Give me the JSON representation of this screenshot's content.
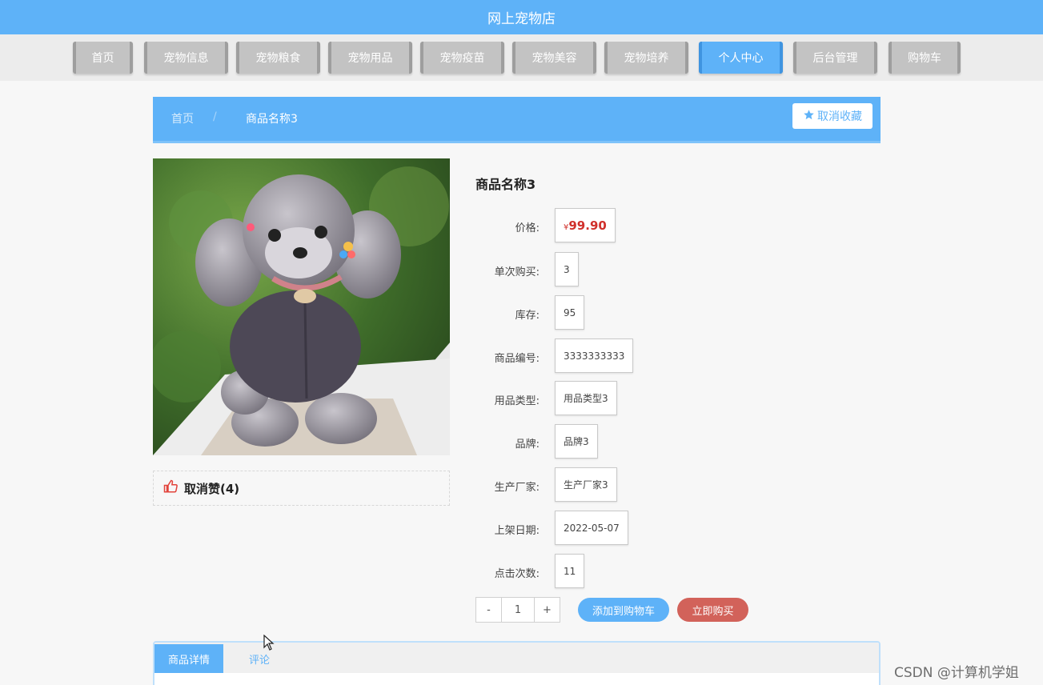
{
  "header": {
    "title": "网上宠物店"
  },
  "nav": {
    "items": [
      {
        "label": "首页",
        "active": false
      },
      {
        "label": "宠物信息",
        "active": false
      },
      {
        "label": "宠物粮食",
        "active": false
      },
      {
        "label": "宠物用品",
        "active": false
      },
      {
        "label": "宠物疫苗",
        "active": false
      },
      {
        "label": "宠物美容",
        "active": false
      },
      {
        "label": "宠物培养",
        "active": false
      },
      {
        "label": "个人中心",
        "active": true
      },
      {
        "label": "后台管理",
        "active": false
      },
      {
        "label": "购物车",
        "active": false
      }
    ]
  },
  "breadcrumb": {
    "home": "首页",
    "separator": "/",
    "current": "商品名称3"
  },
  "favorite": {
    "icon": "star-icon",
    "label": "取消收藏"
  },
  "like": {
    "icon": "thumbs-up-icon",
    "label": "取消赞(4)"
  },
  "product": {
    "name": "商品名称3",
    "price_symbol": "¥",
    "price_value": "99.90",
    "fields": [
      {
        "label": "价格:",
        "value": ""
      },
      {
        "label": "单次购买:",
        "value": "3"
      },
      {
        "label": "库存:",
        "value": "95"
      },
      {
        "label": "商品编号:",
        "value": "3333333333"
      },
      {
        "label": "用品类型:",
        "value": "用品类型3"
      },
      {
        "label": "品牌:",
        "value": "品牌3"
      },
      {
        "label": "生产厂家:",
        "value": "生产厂家3"
      },
      {
        "label": "上架日期:",
        "value": "2022-05-07"
      },
      {
        "label": "点击次数:",
        "value": "11"
      }
    ]
  },
  "quantity": {
    "minus": "-",
    "value": "1",
    "plus": "+"
  },
  "actions": {
    "add_to_cart": "添加到购物车",
    "buy_now": "立即购买"
  },
  "tabs": [
    {
      "label": "商品详情",
      "active": true
    },
    {
      "label": "评论",
      "active": false
    }
  ],
  "watermark": "CSDN @计算机学姐",
  "colors": {
    "primary": "#5eb2f8",
    "price": "#d0302b",
    "buy": "#d2625a"
  }
}
